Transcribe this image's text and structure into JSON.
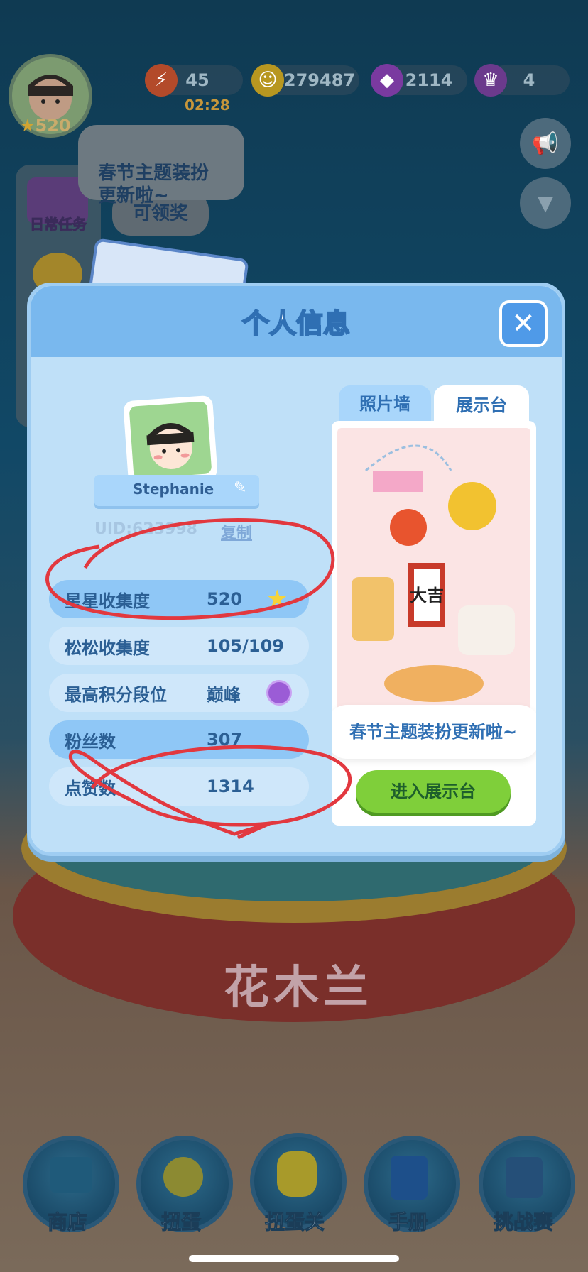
{
  "hud": {
    "level": "520",
    "energy": "45",
    "energy_timer": "02:28",
    "coins": "279487",
    "gems": "2114",
    "crowns": "4"
  },
  "bubbles": {
    "outer_notice": "春节主题装扮\n更新啦~",
    "claim": "可领奖",
    "daily_task": "日常任务"
  },
  "modal": {
    "title": "个人信息",
    "username": "Stephanie",
    "uid": "UID:623998",
    "copy_label": "复制",
    "tabs": [
      {
        "label": "照片墙",
        "active": false
      },
      {
        "label": "展示台",
        "active": true
      }
    ],
    "stats": [
      {
        "label": "星星收集度",
        "value": "520",
        "icon": "star-icon"
      },
      {
        "label": "松松收集度",
        "value": "105/109",
        "icon": ""
      },
      {
        "label": "最高积分段位",
        "value": "巅峰",
        "icon": "rank-badge-icon"
      },
      {
        "label": "粉丝数",
        "value": "307",
        "icon": ""
      },
      {
        "label": "点赞数",
        "value": "1314",
        "icon": ""
      }
    ],
    "showcase_bubble": "春节主题装扮更新啦~",
    "enter_showcase_button": "进入展示台",
    "showcase_sign": "大吉"
  },
  "background_stage_title": "花木兰",
  "bottom_nav": [
    {
      "label": "商店",
      "icon": "shop-icon"
    },
    {
      "label": "扭蛋",
      "icon": "gacha-icon"
    },
    {
      "label": "扭蛋关",
      "icon": "gacha-level-icon"
    },
    {
      "label": "手册",
      "icon": "handbook-icon"
    },
    {
      "label": "挑战赛",
      "icon": "challenge-icon"
    }
  ],
  "colors": {
    "modal_bg": "#bfe0f8",
    "modal_header": "#79b8ee",
    "accent_text": "#2b5f94",
    "green_button": "#7fcf3a",
    "annotation_red": "#e2383f"
  }
}
